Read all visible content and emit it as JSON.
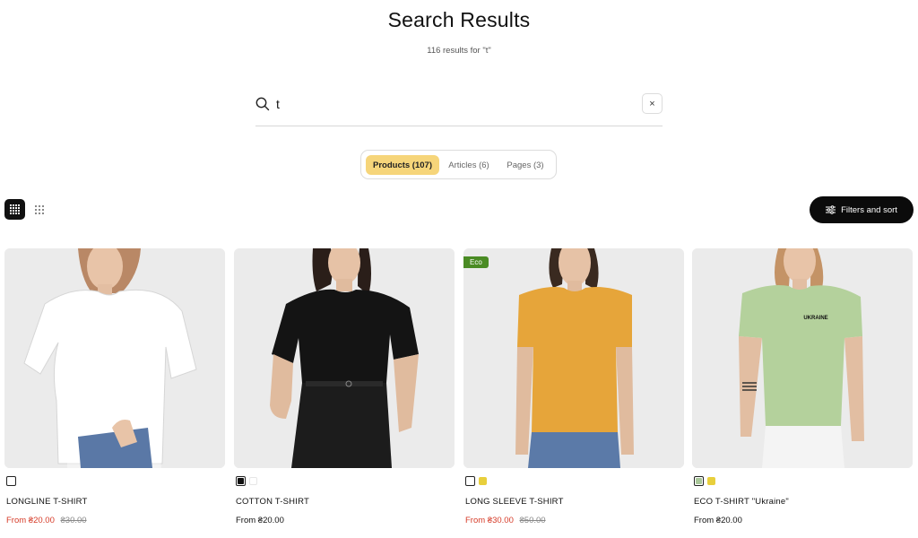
{
  "header": {
    "title": "Search Results",
    "results_count": "116 results for \"t\""
  },
  "search": {
    "value": "t",
    "clear_label": "×"
  },
  "tabs": [
    {
      "label": "Products (107)",
      "active": true
    },
    {
      "label": "Articles (6)",
      "active": false
    },
    {
      "label": "Pages (3)",
      "active": false
    }
  ],
  "toolbar": {
    "filters_label": "Filters and sort",
    "view_modes": [
      "grid-large-icon",
      "grid-small-icon"
    ]
  },
  "products": [
    {
      "name": "LONGLINE T-SHIRT",
      "price_prefix": "From ",
      "price": "From ₴20.00",
      "compare_price": "₴30.00",
      "on_sale": true,
      "badge": "",
      "swatches": [
        "#ffffff"
      ],
      "shirt_color": "#ffffff"
    },
    {
      "name": "COTTON T-SHIRT",
      "price": "From ₴20.00",
      "compare_price": "",
      "on_sale": false,
      "badge": "",
      "swatches": [
        "#111111",
        "#ffffff"
      ],
      "shirt_color": "#141414"
    },
    {
      "name": "LONG SLEEVE T-SHIRT",
      "price": "From ₴30.00",
      "compare_price": "₴50.00",
      "on_sale": true,
      "badge": "Eco",
      "swatches": [
        "#ffffff",
        "#e8cf3c"
      ],
      "shirt_color": "#e6a53a"
    },
    {
      "name": "ECO T-SHIRT \"Ukraine\"",
      "price": "From ₴20.00",
      "compare_price": "",
      "on_sale": false,
      "badge": "",
      "swatches": [
        "#a9c79a",
        "#e8cf3c"
      ],
      "shirt_color": "#b4d19c",
      "print_text": "UKRAINE"
    }
  ],
  "colors": {
    "accent_tab": "#f6d57a",
    "sale": "#d63b28",
    "eco_badge": "#4a8b24"
  }
}
